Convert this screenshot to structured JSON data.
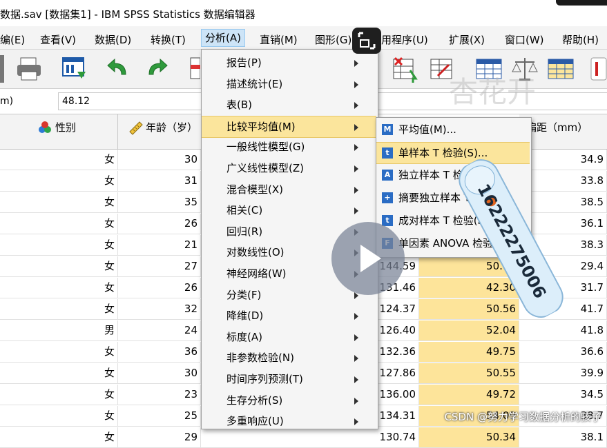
{
  "window": {
    "title": "数据.sav [数据集1] - IBM SPSS Statistics 数据编辑器"
  },
  "menubar": [
    {
      "label": "编(E)"
    },
    {
      "label": "查看(V)"
    },
    {
      "label": "数据(D)"
    },
    {
      "label": "转换(T)"
    },
    {
      "label": "分析(A)"
    },
    {
      "label": "直销(M)"
    },
    {
      "label": "图形(G)"
    },
    {
      "label": "实用程序(U)"
    },
    {
      "label": "扩展(X)"
    },
    {
      "label": "窗口(W)"
    },
    {
      "label": "帮助(H)"
    }
  ],
  "cellbar": {
    "ref": "m)",
    "value": "48.12"
  },
  "columns": {
    "gender": "性别",
    "age": "年龄（岁）",
    "offset": "偏距（mm）"
  },
  "rows": [
    {
      "gender": "女",
      "age": "30",
      "c3": "",
      "c4": "",
      "c5": "34.9"
    },
    {
      "gender": "女",
      "age": "31",
      "c3": "",
      "c4": "",
      "c5": "33.8"
    },
    {
      "gender": "女",
      "age": "35",
      "c3": "",
      "c4": "",
      "c5": "38.5"
    },
    {
      "gender": "女",
      "age": "26",
      "c3": "",
      "c4": "",
      "c5": "36.1"
    },
    {
      "gender": "女",
      "age": "21",
      "c3": "",
      "c4": "",
      "c5": "38.3"
    },
    {
      "gender": "女",
      "age": "27",
      "c3": "144.59",
      "c4": "50.82",
      "c5": "29.4"
    },
    {
      "gender": "女",
      "age": "26",
      "c3": "131.46",
      "c4": "42.30",
      "c5": "31.7"
    },
    {
      "gender": "女",
      "age": "32",
      "c3": "124.37",
      "c4": "50.56",
      "c5": "41.7"
    },
    {
      "gender": "男",
      "age": "24",
      "c3": "126.40",
      "c4": "52.04",
      "c5": "41.8"
    },
    {
      "gender": "女",
      "age": "36",
      "c3": "132.36",
      "c4": "49.75",
      "c5": "36.6"
    },
    {
      "gender": "女",
      "age": "30",
      "c3": "127.86",
      "c4": "50.55",
      "c5": "39.9"
    },
    {
      "gender": "女",
      "age": "23",
      "c3": "136.00",
      "c4": "49.72",
      "c5": "34.5"
    },
    {
      "gender": "女",
      "age": "25",
      "c3": "134.31",
      "c4": "54.09",
      "c5": "38.7"
    },
    {
      "gender": "女",
      "age": "29",
      "c3": "130.74",
      "c4": "50.34",
      "c5": "38.1"
    }
  ],
  "analyze_menu": [
    {
      "label": "报告(P)"
    },
    {
      "label": "描述统计(E)"
    },
    {
      "label": "表(B)"
    },
    {
      "label": "比较平均值(M)",
      "selected": true
    },
    {
      "label": "一般线性模型(G)"
    },
    {
      "label": "广义线性模型(Z)"
    },
    {
      "label": "混合模型(X)"
    },
    {
      "label": "相关(C)"
    },
    {
      "label": "回归(R)"
    },
    {
      "label": "对数线性(O)"
    },
    {
      "label": "神经网络(W)"
    },
    {
      "label": "分类(F)"
    },
    {
      "label": "降维(D)"
    },
    {
      "label": "标度(A)"
    },
    {
      "label": "非参数检验(N)"
    },
    {
      "label": "时间序列预测(T)"
    },
    {
      "label": "生存分析(S)"
    },
    {
      "label": "多重响应(U)"
    }
  ],
  "compare_means_submenu": [
    {
      "label": "平均值(M)...",
      "icon": "means-icon"
    },
    {
      "label": "单样本 T 检验(S)...",
      "icon": "one-sample-t-icon",
      "selected": true
    },
    {
      "label": "独立样本 T 检验...",
      "icon": "independent-t-icon"
    },
    {
      "label": "摘要独立样本 T 检验",
      "icon": "summary-t-icon"
    },
    {
      "label": "成对样本 T 检验(P)...",
      "icon": "paired-t-icon"
    },
    {
      "label": "单因素 ANOVA 检验...",
      "icon": "anova-icon"
    }
  ],
  "sticker_text": "16222275006",
  "watermark": "CSDN @努力学习数据分析的孩子",
  "overlay_watermark": "杏花开"
}
